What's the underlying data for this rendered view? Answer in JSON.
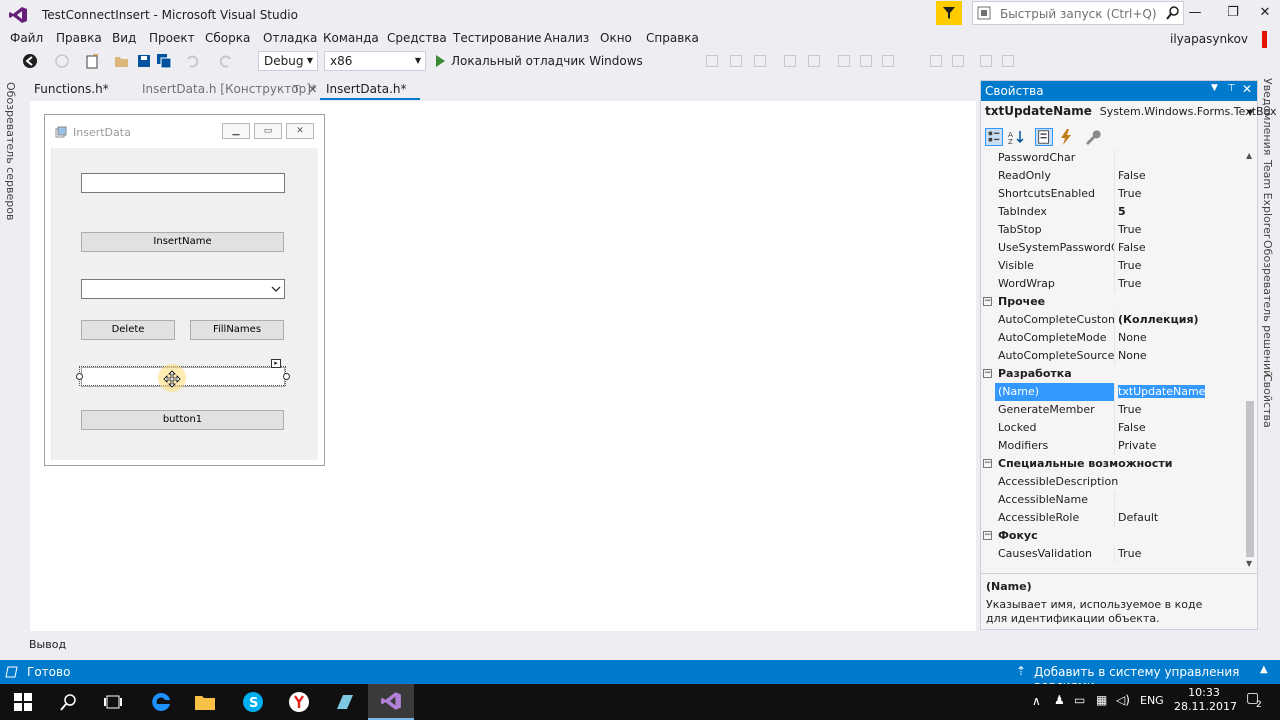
{
  "window": {
    "title": "TestConnectInsert - Microsoft Visual Studio",
    "quick_launch_placeholder": "Быстрый запуск (Ctrl+Q)",
    "user": "ilyapasynkov",
    "controls": {
      "minimize": "—",
      "maximize": "❐",
      "close": "✕"
    }
  },
  "menu": [
    "Файл",
    "Правка",
    "Вид",
    "Проект",
    "Сборка",
    "Отладка",
    "Команда",
    "Средства",
    "Тестирование",
    "Анализ",
    "Окно",
    "Справка"
  ],
  "toolbar": {
    "config": "Debug",
    "platform": "x86",
    "run_label": "Локальный отладчик Windows"
  },
  "left_strip": {
    "label": "Обозреватель серверов"
  },
  "right_strip": {
    "tabs": [
      "Уведомления",
      "Team Explorer",
      "Обозреватель решений",
      "Свойства"
    ]
  },
  "doc_tabs": [
    {
      "label": "Functions.h*"
    },
    {
      "label": "InsertData.h [Конструктор]*",
      "pin": "⊤",
      "close": "✕"
    },
    {
      "label": "InsertData.h*"
    }
  ],
  "designer_form": {
    "title": "InsertData",
    "buttons": {
      "insert_name": "InsertName",
      "delete": "Delete",
      "fill_names": "FillNames",
      "button1": "button1"
    }
  },
  "properties": {
    "header": "Свойства",
    "object_name": "txtUpdateName",
    "object_type": "System.Windows.Forms.TextBox",
    "rows": [
      {
        "name": "PasswordChar",
        "value": ""
      },
      {
        "name": "ReadOnly",
        "value": "False"
      },
      {
        "name": "ShortcutsEnabled",
        "value": "True"
      },
      {
        "name": "TabIndex",
        "value": "5",
        "bold": true
      },
      {
        "name": "TabStop",
        "value": "True"
      },
      {
        "name": "UseSystemPasswordCh",
        "value": "False"
      },
      {
        "name": "Visible",
        "value": "True"
      },
      {
        "name": "WordWrap",
        "value": "True"
      }
    ],
    "cat_other": "Прочее",
    "other_rows": [
      {
        "name": "AutoCompleteCustomS",
        "value": "(Коллекция)",
        "bold": true
      },
      {
        "name": "AutoCompleteMode",
        "value": "None"
      },
      {
        "name": "AutoCompleteSource",
        "value": "None"
      }
    ],
    "cat_design": "Разработка",
    "design_rows": [
      {
        "name": "(Name)",
        "value": "txtUpdateName",
        "selected": true
      },
      {
        "name": "GenerateMember",
        "value": "True"
      },
      {
        "name": "Locked",
        "value": "False"
      },
      {
        "name": "Modifiers",
        "value": "Private"
      }
    ],
    "cat_access": "Специальные возможности",
    "access_rows": [
      {
        "name": "AccessibleDescription",
        "value": ""
      },
      {
        "name": "AccessibleName",
        "value": ""
      },
      {
        "name": "AccessibleRole",
        "value": "Default"
      }
    ],
    "cat_focus": "Фокус",
    "focus_rows": [
      {
        "name": "CausesValidation",
        "value": "True"
      }
    ],
    "desc_title": "(Name)",
    "desc_text": "Указывает имя, используемое в коде для идентификации объекта."
  },
  "output_label": "Вывод",
  "status": {
    "left": "Готово",
    "right": "Добавить в систему управления версиями"
  },
  "tray": {
    "lang": "ENG",
    "time": "10:33",
    "date": "28.11.2017",
    "notifications": "2"
  },
  "colors": {
    "accent": "#007acc",
    "vs_purple": "#68217a",
    "filter_yellow": "#ffcc00"
  }
}
